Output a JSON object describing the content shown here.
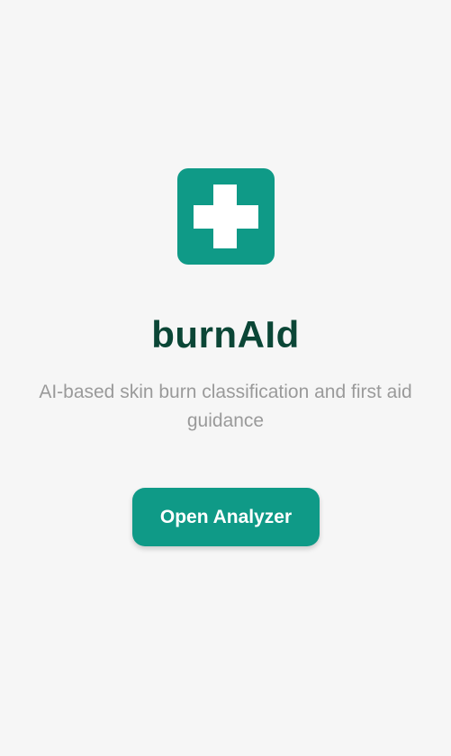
{
  "app": {
    "name": "burnAId",
    "tagline": "AI-based skin burn classification and first aid guidance"
  },
  "logo": {
    "icon": "first-aid-cross-icon",
    "background_color": "#0f9a87",
    "symbol_color": "#ffffff"
  },
  "actions": {
    "open_analyzer_label": "Open Analyzer"
  },
  "colors": {
    "background": "#f6f6f6",
    "accent": "#0f9a87",
    "title": "#0b4636",
    "subtitle": "#9a9a9a"
  }
}
